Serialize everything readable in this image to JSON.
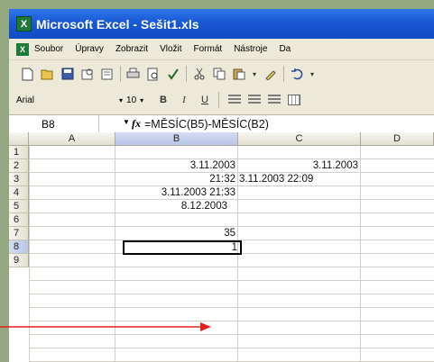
{
  "window": {
    "title": "Microsoft Excel - Sešit1.xls",
    "app_icon_glyph": "X"
  },
  "menu": [
    "Soubor",
    "Úpravy",
    "Zobrazit",
    "Vložit",
    "Formát",
    "Nástroje",
    "Da"
  ],
  "toolbar": {
    "buttons": [
      "new-icon",
      "open-icon",
      "save-icon",
      "permission-icon",
      "email-icon",
      "print-icon",
      "print-preview-icon",
      "spelling-icon",
      "cut-icon",
      "copy-icon",
      "paste-icon",
      "format-painter-icon",
      "undo-icon"
    ]
  },
  "format_toolbar": {
    "font": "Arial",
    "size": "10",
    "bold": "B",
    "italic": "I",
    "underline": "U"
  },
  "formula_bar": {
    "name_box": "B8",
    "fx": "fx",
    "formula": "=MĚSÍC(B5)-MĚSÍC(B2)"
  },
  "sheet": {
    "columns": [
      "A",
      "B",
      "C",
      "D"
    ],
    "rows": [
      "1",
      "2",
      "3",
      "4",
      "5",
      "6",
      "7",
      "8",
      "9"
    ],
    "cells": {
      "B2": "3.11.2003",
      "C2": "3.11.2003",
      "B3": "21:32",
      "C3": "3.11.2003 22:09",
      "B4": "3.11.2003 21:33",
      "B5": "8.12.2003",
      "B7": "35",
      "B8": "1"
    },
    "selected_cell": "B8"
  },
  "colors": {
    "background": "#93a781",
    "titlebar": "#1858d6",
    "arrow": "#e0201c"
  }
}
